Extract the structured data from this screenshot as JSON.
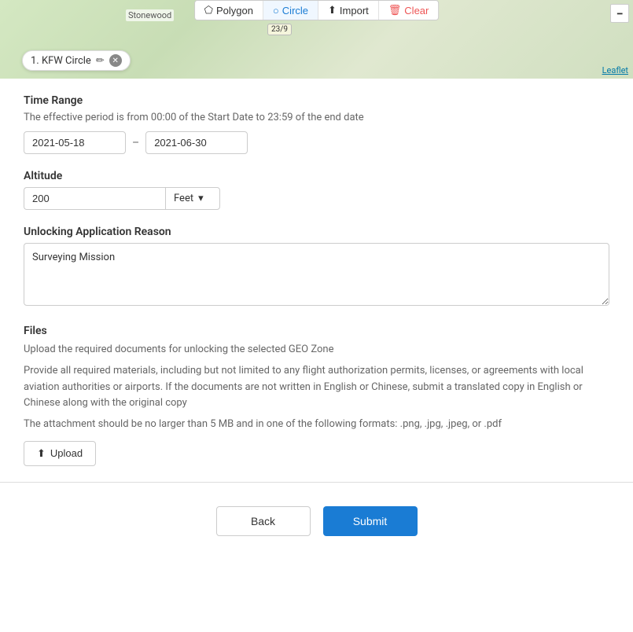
{
  "map": {
    "toolbar": {
      "polygon_label": "Polygon",
      "circle_label": "Circle",
      "import_label": "Import",
      "clear_label": "Clear"
    },
    "zoom_minus": "−",
    "leaflet_label": "Leaflet",
    "stonewood_label": "Stonewood",
    "road_number": "23/9",
    "kfw_badge": "1. KFW Circle",
    "kfw_badge_full": "1. KFW Circle ✏ ×"
  },
  "time_range": {
    "section_label": "Time Range",
    "hint": "The effective period is from 00:00 of the Start Date to 23:59 of the end date",
    "start_date": "2021-05-18",
    "separator": "–",
    "end_date": "2021-06-30"
  },
  "altitude": {
    "section_label": "Altitude",
    "value": "200",
    "unit": "Feet",
    "chevron": "▾"
  },
  "reason": {
    "section_label": "Unlocking Application Reason",
    "value": "Surveying Mission"
  },
  "files": {
    "section_label": "Files",
    "desc1": "Upload the required documents for unlocking the selected GEO Zone",
    "desc2": "Provide all required materials, including but not limited to any flight authorization permits, licenses, or agreements with local aviation authorities or airports. If the documents are not written in English or Chinese, submit a translated copy in English or Chinese along with the original copy",
    "desc3": "The attachment should be no larger than 5 MB and in one of the following formats: .png, .jpg, .jpeg, or .pdf",
    "upload_label": "Upload",
    "upload_icon": "⬆"
  },
  "actions": {
    "back_label": "Back",
    "submit_label": "Submit"
  }
}
